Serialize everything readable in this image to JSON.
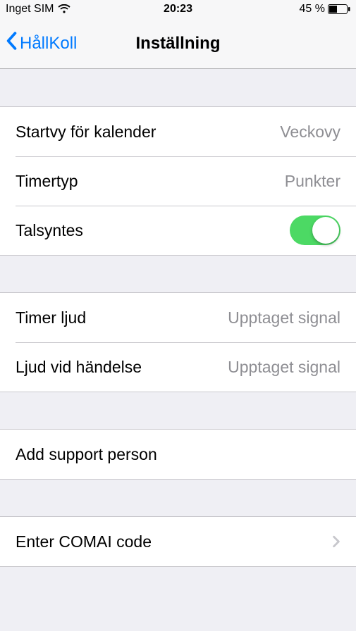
{
  "status": {
    "carrier": "Inget SIM",
    "time": "20:23",
    "battery_text": "45 %"
  },
  "nav": {
    "back_label": "HållKoll",
    "title": "Inställning"
  },
  "group1": {
    "row0": {
      "label": "Startvy för kalender",
      "value": "Veckovy"
    },
    "row1": {
      "label": "Timertyp",
      "value": "Punkter"
    },
    "row2": {
      "label": "Talsyntes"
    }
  },
  "group2": {
    "row0": {
      "label": "Timer ljud",
      "value": "Upptaget signal"
    },
    "row1": {
      "label": "Ljud vid händelse",
      "value": "Upptaget signal"
    }
  },
  "group3": {
    "row0": {
      "label": "Add support person"
    }
  },
  "group4": {
    "row0": {
      "label": "Enter COMAI code"
    }
  }
}
